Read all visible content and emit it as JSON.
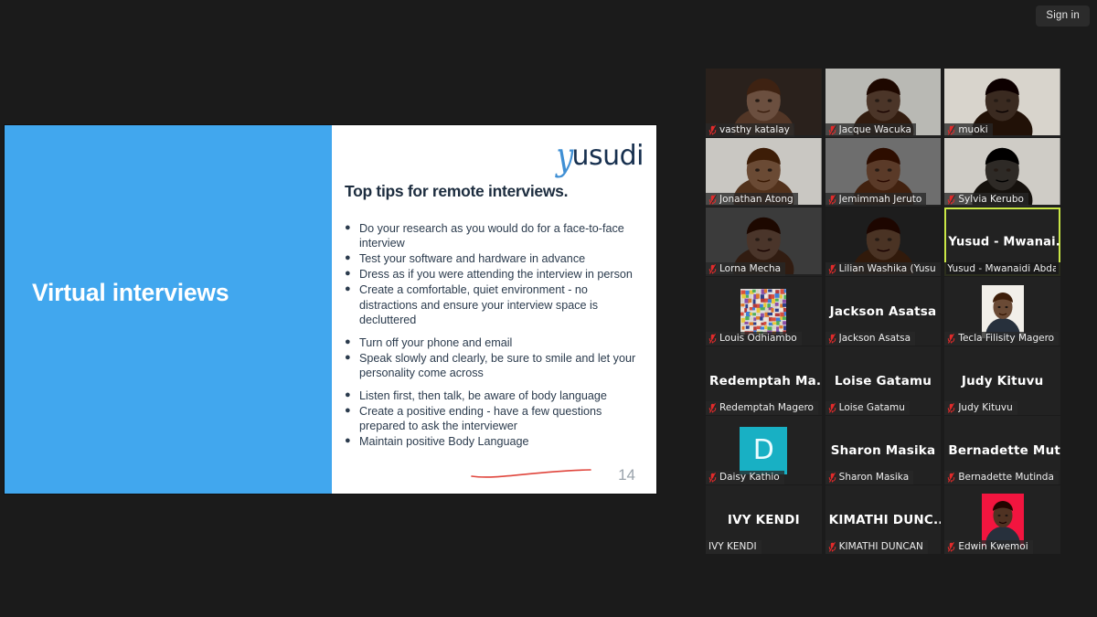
{
  "topbar": {
    "sign_in_label": "Sign in"
  },
  "slide": {
    "title": "Virtual interviews",
    "logo_script_letter": "y",
    "logo_word": "usudi",
    "heading": "Top tips for remote interviews.",
    "page_number": "14",
    "bullet_groups": [
      [
        "Do your research as you would do for a face-to-face interview",
        "Test your software and hardware in advance",
        "Dress as if you were attending the interview in person",
        "Create a comfortable, quiet environment - no distractions and ensure  your interview space is decluttered"
      ],
      [
        "Turn off your phone and email",
        "Speak slowly and clearly, be sure to smile and let your personality  come across"
      ],
      [
        "Listen first, then talk, be aware of body language",
        "Create a positive ending - have a few questions prepared to ask  the interviewer",
        "Maintain positive Body Language"
      ]
    ],
    "colors": {
      "panel_blue": "#41a7ee",
      "heading": "#1d2d3f",
      "body": "#2b3b4d",
      "annotation_red": "#e0453c"
    }
  },
  "grid": {
    "speaking_border_color": "#c9e646",
    "participants": [
      {
        "label": "vasthy katalay",
        "muted": true,
        "display": "video",
        "big_name": "",
        "skin": "#6b4f3f",
        "bg": "#2a211c"
      },
      {
        "label": "Jacque Wacuka",
        "muted": true,
        "display": "video",
        "big_name": "",
        "skin": "#4b3528",
        "bg": "#b9b9b4"
      },
      {
        "label": "muoki",
        "muted": true,
        "display": "video",
        "big_name": "",
        "skin": "#3a2a20",
        "bg": "#d8d4cc"
      },
      {
        "label": "Jonathan Atong",
        "muted": true,
        "display": "video",
        "big_name": "",
        "skin": "#6a4a34",
        "bg": "#c9c7c2"
      },
      {
        "label": "Jemimmah Jeruto",
        "muted": true,
        "display": "video",
        "big_name": "",
        "skin": "#5a3a28",
        "bg": "#6e6e6e"
      },
      {
        "label": "Sylvia Kerubo",
        "muted": true,
        "display": "video",
        "big_name": "",
        "skin": "#2e2a26",
        "bg": "#cfccc6"
      },
      {
        "label": "Lorna Mecha",
        "muted": true,
        "display": "video",
        "big_name": "",
        "skin": "#4a352a",
        "bg": "#3b3b3b"
      },
      {
        "label": "Lilian Washika (Yusudi)",
        "muted": true,
        "display": "video",
        "big_name": "",
        "skin": "#4a3324",
        "bg": "#1d1d1d"
      },
      {
        "label": "Yusud - Mwanaidi Abdallah",
        "muted": false,
        "display": "name",
        "big_name": "Yusud  -  Mwanai...",
        "speaking": true
      },
      {
        "label": "Louis Odhiambo",
        "muted": true,
        "display": "avatar-collage",
        "big_name": ""
      },
      {
        "label": "Jackson Asatsa",
        "muted": true,
        "display": "name",
        "big_name": "Jackson Asatsa"
      },
      {
        "label": "Tecla Filisity Magero",
        "muted": true,
        "display": "avatar-photo",
        "big_name": "",
        "skin": "#6a4a35",
        "bg": "#f2efe9"
      },
      {
        "label": "Redemptah Magero",
        "muted": true,
        "display": "name",
        "big_name": "Redemptah  Ma..."
      },
      {
        "label": "Loise Gatamu",
        "muted": true,
        "display": "name",
        "big_name": "Loise Gatamu"
      },
      {
        "label": "Judy Kituvu",
        "muted": true,
        "display": "name",
        "big_name": "Judy Kituvu"
      },
      {
        "label": "Daisy Kathio",
        "muted": true,
        "display": "avatar-letter",
        "big_name": "",
        "letter": "D",
        "letter_bg": "#18b0c4"
      },
      {
        "label": "Sharon Masika",
        "muted": true,
        "display": "name",
        "big_name": "Sharon Masika"
      },
      {
        "label": "Bernadette Mutinda",
        "muted": true,
        "display": "name",
        "big_name": "Bernadette  Mut..."
      },
      {
        "label": "IVY KENDI",
        "muted": false,
        "display": "name",
        "big_name": "IVY KENDI"
      },
      {
        "label": "KIMATHI DUNCAN",
        "muted": true,
        "display": "name",
        "big_name": "KIMATHI  DUNC..."
      },
      {
        "label": "Edwin Kwemoi",
        "muted": true,
        "display": "avatar-photo-red",
        "big_name": "",
        "skin": "#4f3222",
        "bg": "#f2153f"
      }
    ]
  }
}
